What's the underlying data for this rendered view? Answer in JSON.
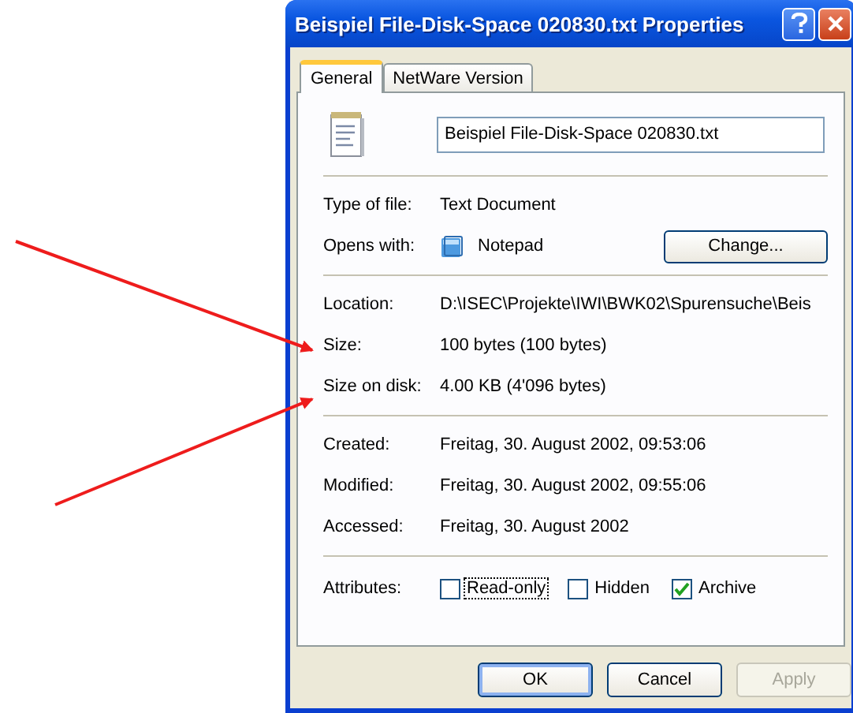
{
  "window": {
    "title": "Beispiel File-Disk-Space 020830.txt Properties"
  },
  "tabs": [
    {
      "label": "General",
      "selected": true
    },
    {
      "label": "NetWare Version",
      "selected": false
    }
  ],
  "file_name": {
    "value": "Beispiel File-Disk-Space 020830.txt"
  },
  "sections": [
    [
      {
        "label": "Type of file:",
        "value": "Text Document",
        "kind": "text"
      },
      {
        "label": "Opens with:",
        "value": "Notepad",
        "kind": "app",
        "button": "Change..."
      }
    ],
    [
      {
        "label": "Location:",
        "value": "D:\\ISEC\\Projekte\\IWI\\BWK02\\Spurensuche\\Beis",
        "kind": "text"
      },
      {
        "label": "Size:",
        "value": "100 bytes (100 bytes)",
        "kind": "text"
      },
      {
        "label": "Size on disk:",
        "value": "4.00 KB (4'096 bytes)",
        "kind": "text"
      }
    ],
    [
      {
        "label": "Created:",
        "value": "Freitag, 30. August 2002, 09:53:06",
        "kind": "text"
      },
      {
        "label": "Modified:",
        "value": "Freitag, 30. August 2002, 09:55:06",
        "kind": "text"
      },
      {
        "label": "Accessed:",
        "value": "Freitag, 30. August 2002",
        "kind": "text"
      }
    ]
  ],
  "attributes": {
    "label": "Attributes:",
    "items": [
      {
        "label": "Read-only",
        "checked": false,
        "focused": true
      },
      {
        "label": "Hidden",
        "checked": false,
        "focused": false
      },
      {
        "label": "Archive",
        "checked": true,
        "focused": false
      }
    ]
  },
  "buttons": [
    {
      "label": "OK",
      "default": true,
      "disabled": false
    },
    {
      "label": "Cancel",
      "default": false,
      "disabled": false
    },
    {
      "label": "Apply",
      "default": false,
      "disabled": true
    }
  ]
}
